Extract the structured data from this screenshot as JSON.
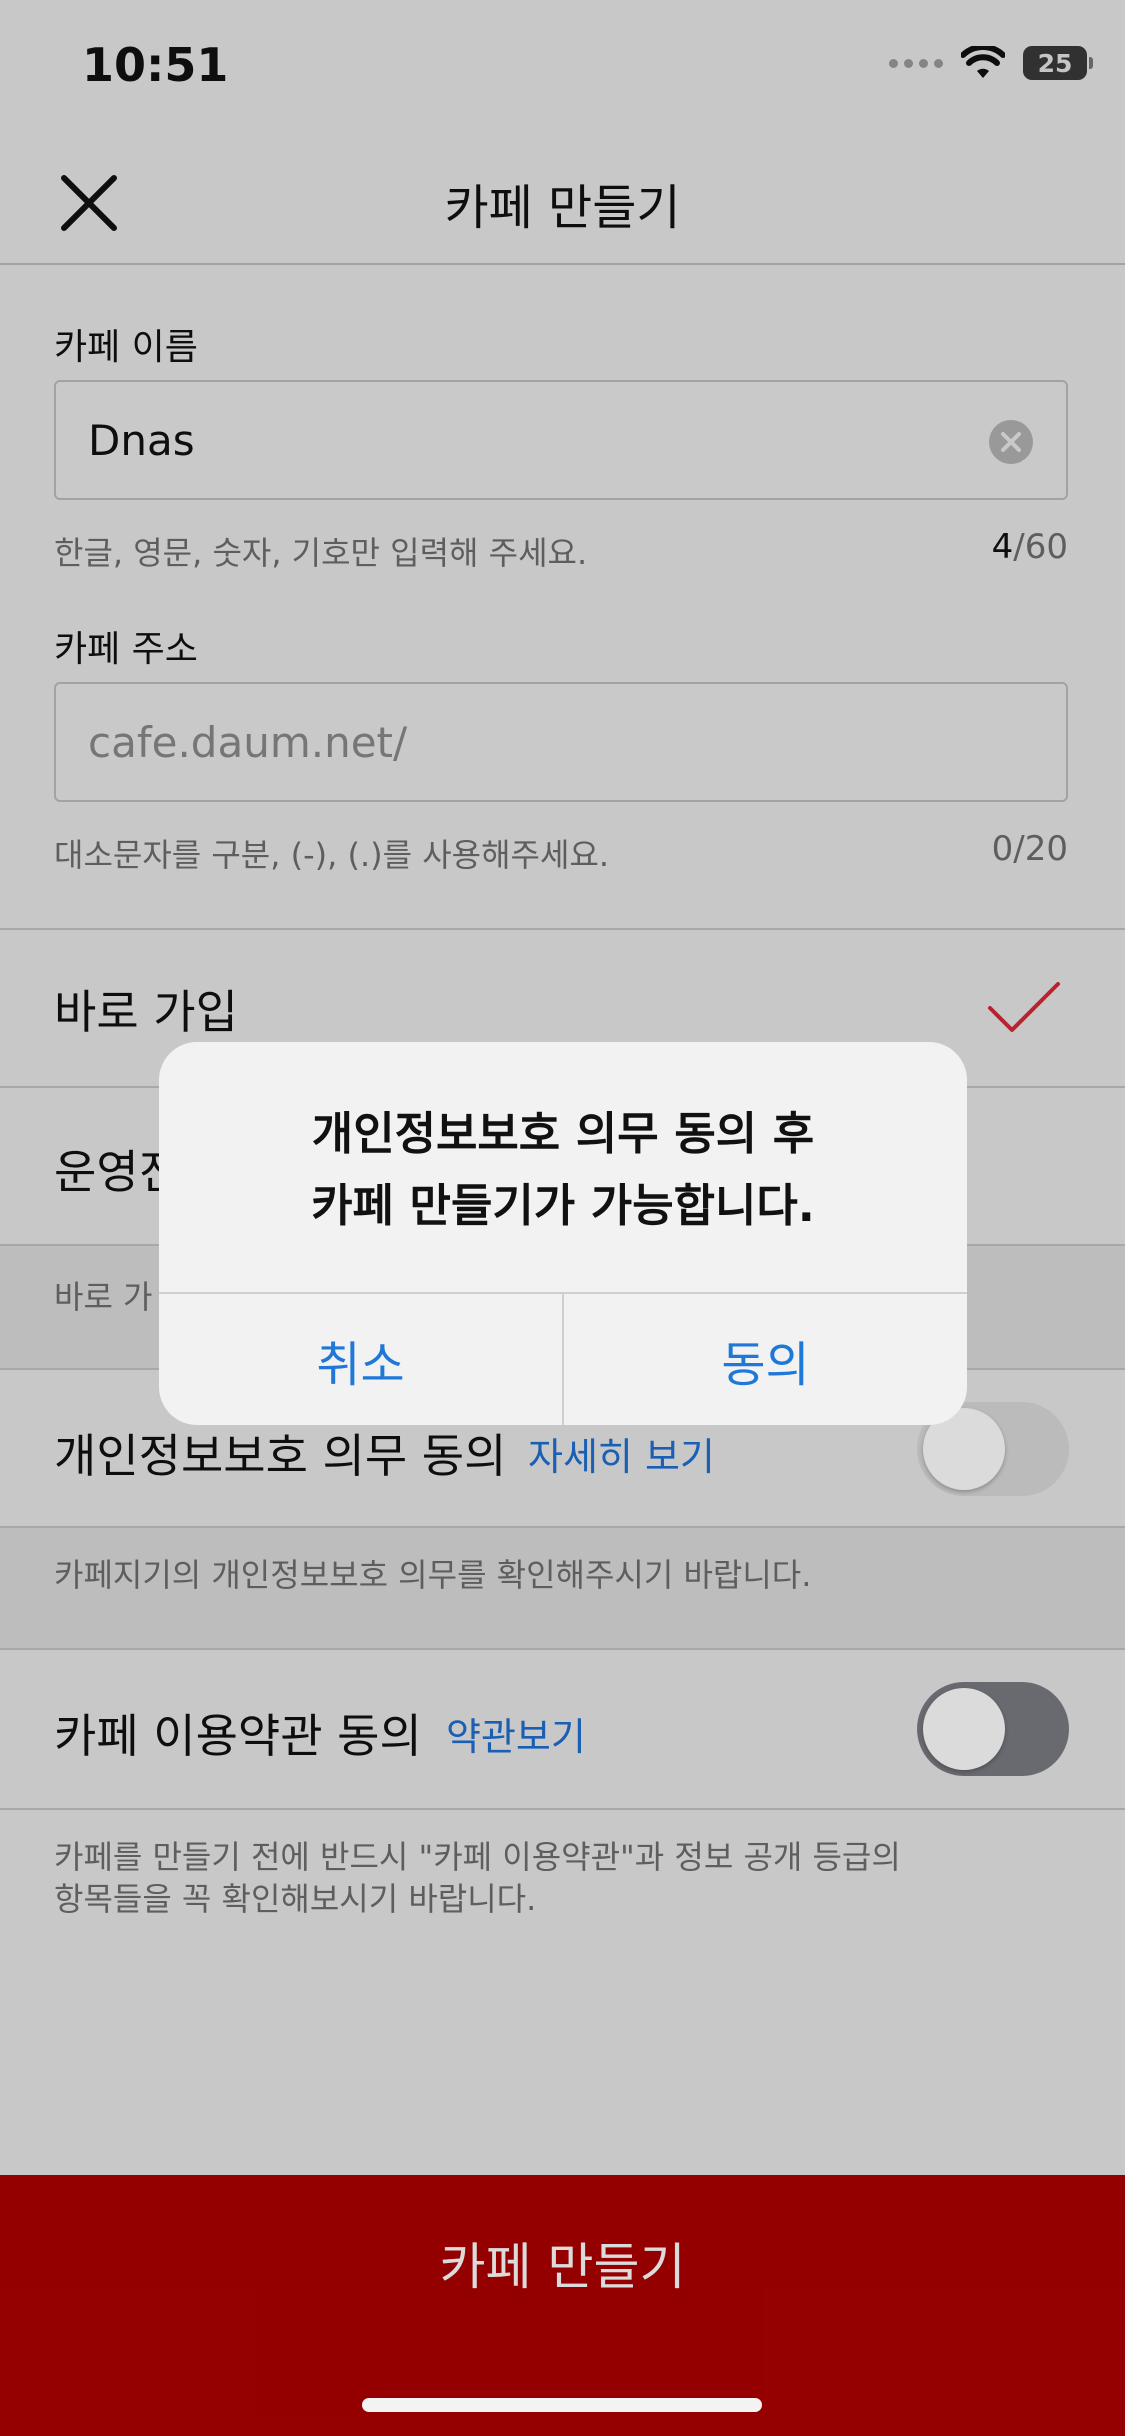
{
  "status_bar": {
    "time": "10:51",
    "battery": "25"
  },
  "nav": {
    "title": "카페 만들기"
  },
  "cafe_name": {
    "label": "카페 이름",
    "value": "Dnas",
    "hint": "한글, 영문, 숫자, 기호만 입력해 주세요.",
    "count": "4",
    "max": "/60"
  },
  "cafe_address": {
    "label": "카페 주소",
    "placeholder": "cafe.daum.net/",
    "hint": "대소문자를 구분, (-), (.)를 사용해주세요.",
    "count": "0/20"
  },
  "join_option": {
    "label": "바로 가입",
    "checked": true
  },
  "approval_option": {
    "label": "운영진"
  },
  "join_hint": "바로 가",
  "privacy": {
    "label": "개인정보보호 의무 동의",
    "link": "자세히 보기",
    "description": "카페지기의 개인정보보호 의무를 확인해주시기 바랍니다.",
    "enabled": false
  },
  "terms": {
    "label": "카페 이용약관 동의",
    "link": "약관보기",
    "description_line1": "카페를 만들기 전에 반드시 \"카페 이용약관\"과 정보 공개 등급의",
    "description_line2": "항목들을 꼭 확인해보시기 바랍니다.",
    "enabled": false
  },
  "bottom_button": {
    "label": "카페 만들기"
  },
  "alert": {
    "line1": "개인정보보호 의무 동의 후",
    "line2": "카페 만들기가 가능합니다.",
    "cancel": "취소",
    "agree": "동의"
  },
  "colors": {
    "accent_red": "#ad0000",
    "check_red": "#d8283a",
    "link_blue": "#1f6fd1",
    "alert_button_blue": "#1f78d8"
  }
}
